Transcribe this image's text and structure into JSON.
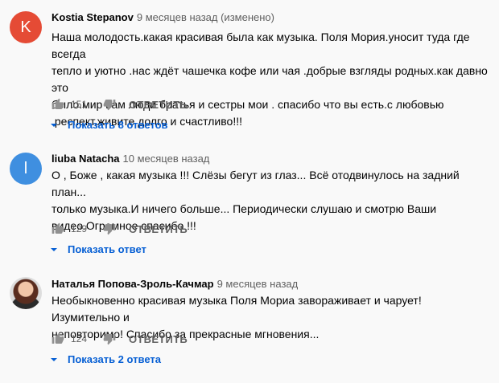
{
  "comments": [
    {
      "avatar_letter": "K",
      "avatar_color": "#e54b35",
      "author": "Kostia Stepanov",
      "time": "9 месяцев назад (изменено)",
      "text_lines": [
        "Наша молодость.какая красивая была как музыка. Поля Мория.уносит туда где всегда",
        "тепло и уютно .нас ждёт чашечка кофе или чая .добрые взгляды родных.как давно это",
        "было.мир вам люди братья и сестры мои . спасибо что вы есть.с любовью",
        ".респект.живите долго и счастливо!!!"
      ],
      "likes": "151",
      "reply_label": "ОТВЕТИТЬ",
      "replies_label": "Показать 8 ответов"
    },
    {
      "avatar_letter": "l",
      "avatar_color": "#3f8fe0",
      "author": "liuba Natacha",
      "time": "10 месяцев назад",
      "text_lines": [
        "О , Боже , какая музыка !!! Слёзы бегут из глаз... Всё  отодвинулось на задний план...",
        "только музыка.И ничего больше... Периодически слушаю и смотрю Ваши",
        "видео.Огромное спасибо !!!"
      ],
      "likes": "129",
      "reply_label": "ОТВЕТИТЬ",
      "replies_label": "Показать ответ"
    },
    {
      "avatar_letter": "",
      "avatar_color": "#dddddd",
      "author": "Наталья Попова-Зроль-Качмар",
      "time": "9 месяцев назад",
      "text_lines": [
        "Необыкновенно красивая музыка Поля Мориа завораживает и чарует! Изумительно и",
        "неповторимо! Спасибо за прекрасные мгновения..."
      ],
      "likes": "124",
      "reply_label": "ОТВЕТИТЬ",
      "replies_label": "Показать 2 ответа"
    }
  ]
}
